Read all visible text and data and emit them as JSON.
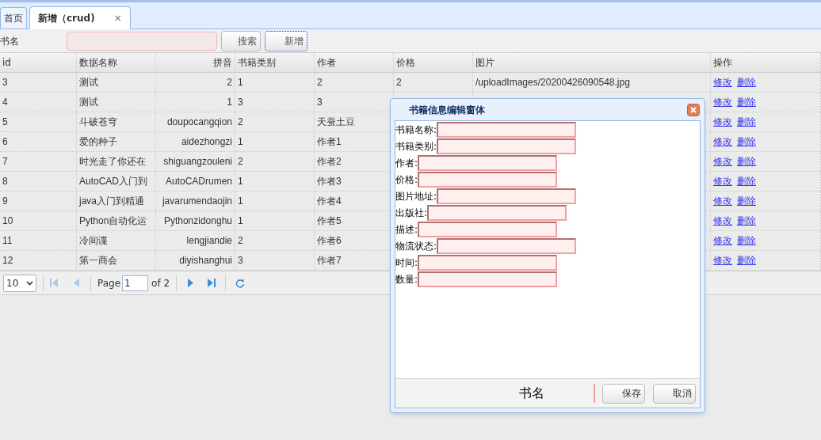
{
  "tabs": [
    {
      "label": "首页",
      "selected": false
    },
    {
      "label": "新增（crud)",
      "selected": true,
      "close": "×"
    }
  ],
  "toolbar": {
    "label": "书名",
    "buttons": [
      "搜索",
      "新增"
    ]
  },
  "table": {
    "columns": [
      "id",
      "数据名称",
      "拼音",
      "书籍类别",
      "作者",
      "价格",
      "图片",
      "操作"
    ],
    "rows": [
      {
        "cells": [
          "3",
          "测试",
          "2",
          "1",
          "2",
          "2",
          "/uploadImages/20200426090548.jpg"
        ],
        "actions": [
          "修改",
          "删除"
        ]
      },
      {
        "cells": [
          "4",
          "测试",
          "1",
          "3",
          "3"
        ],
        "actions": [
          "修改",
          "删除"
        ]
      },
      {
        "cells": [
          "5",
          "斗破苍穹",
          "doupocangqion",
          "2",
          "天蚕土豆"
        ],
        "actions": [
          "修改",
          "删除"
        ]
      },
      {
        "cells": [
          "6",
          "爱的种子",
          "aidezhongzi",
          "1",
          "作者1"
        ],
        "actions": [
          "修改",
          "删除"
        ]
      },
      {
        "cells": [
          "7",
          "时光走了你还在",
          "shiguangzouleni",
          "2",
          "作者2"
        ],
        "actions": [
          "修改",
          "删除"
        ]
      },
      {
        "cells": [
          "8",
          "AutoCAD入门到",
          "AutoCADrumen",
          "1",
          "作者3"
        ],
        "actions": [
          "修改",
          "删除"
        ]
      },
      {
        "cells": [
          "9",
          "java入门到精通",
          "javarumendaojin",
          "1",
          "作者4"
        ],
        "actions": [
          "修改",
          "删除"
        ]
      },
      {
        "cells": [
          "10",
          "Python自动化运",
          "Pythonzidonghu",
          "1",
          "作者5"
        ],
        "actions": [
          "修改",
          "删除"
        ]
      },
      {
        "cells": [
          "11",
          "冷间谍",
          "lengjiandie",
          "2",
          "作者6"
        ],
        "actions": [
          "修改",
          "删除"
        ]
      },
      {
        "cells": [
          "12",
          "第一商会",
          "diyishanghui",
          "3",
          "作者7"
        ],
        "actions": [
          "修改",
          "删除"
        ]
      }
    ]
  },
  "pager": {
    "page_size": "10",
    "page_label": "Page",
    "page": "1",
    "of": "of 2"
  },
  "dialog": {
    "title": "书籍信息编辑窗体",
    "fields": [
      "书籍名称:",
      "书籍类别:",
      "作者:",
      "价格:",
      "图片地址:",
      "出版社:",
      "描述:",
      "物流状态:",
      "时间:",
      "数量:"
    ],
    "footer_text": "书名",
    "buttons": [
      "保存",
      "取消"
    ]
  }
}
